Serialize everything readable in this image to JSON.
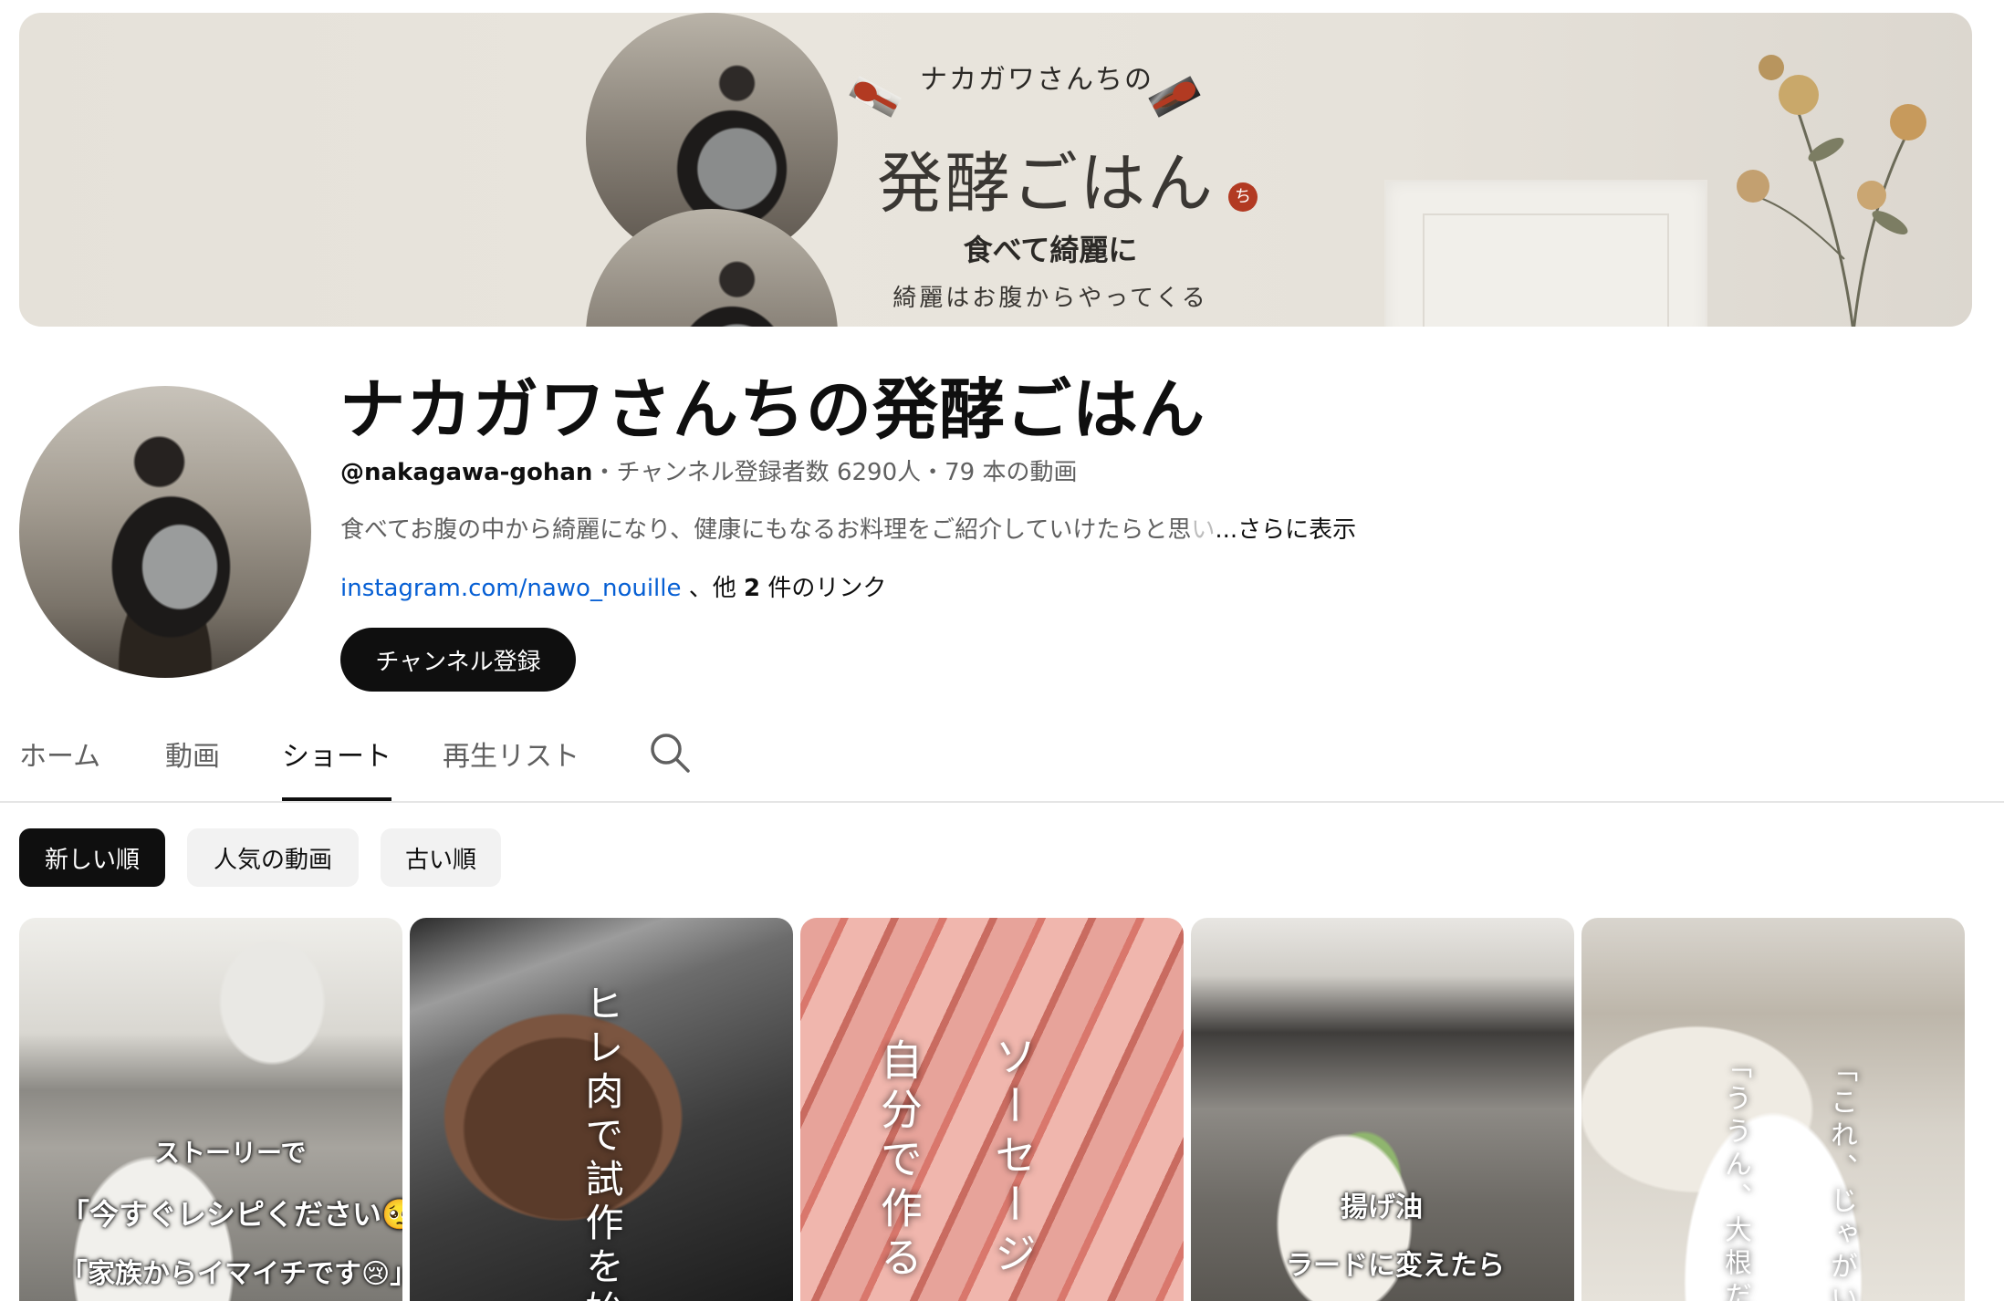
{
  "banner": {
    "subtitle_top": "ナカガワさんちの",
    "title": "発酵ごはん",
    "seal": "ち",
    "tagline": "食べて綺麗に",
    "tagline2": "綺麗はお腹からやってくる"
  },
  "channel": {
    "title": "ナカガワさんちの発酵ごはん",
    "handle": "@nakagawa-gohan",
    "stats": "・チャンネル登録者数 6290人・79 本の動画",
    "description_visible": "食べてお腹の中から綺麗になり、健康にもなるお料理をご紹介していけたらと思",
    "description_fade": "い",
    "more": "...さらに表示",
    "link": "instagram.com/nawo_nouille",
    "other_links_prefix": "、他 ",
    "other_links_count": "2",
    "other_links_suffix": " 件のリンク",
    "subscribe_label": "チャンネル登録"
  },
  "tabs": [
    {
      "label": "ホーム"
    },
    {
      "label": "動画"
    },
    {
      "label": "ショート",
      "active": true
    },
    {
      "label": "再生リスト"
    }
  ],
  "search_icon": "search-icon",
  "chips": [
    {
      "label": "新しい順",
      "active": true
    },
    {
      "label": "人気の動画"
    },
    {
      "label": "古い順"
    }
  ],
  "shorts": [
    {
      "captions": [
        "ストーリーで",
        "「今すぐレシピください🥺」",
        "「家族からイマイチです😢」"
      ]
    },
    {
      "vertical_text": "ヒレ肉で試作を始"
    },
    {
      "vertical_text": [
        "ソーセージ",
        "自分で作る"
      ]
    },
    {
      "captions": [
        "揚げ油",
        "ラードに変えたら"
      ]
    },
    {
      "vertical_text": [
        "「これ、じゃがい",
        "「ううん、大根だ"
      ]
    }
  ],
  "colors": {
    "link": "#065fd4",
    "primary": "#0f0f0f",
    "secondary_text": "#606060",
    "chip_bg": "#f2f2f2"
  }
}
